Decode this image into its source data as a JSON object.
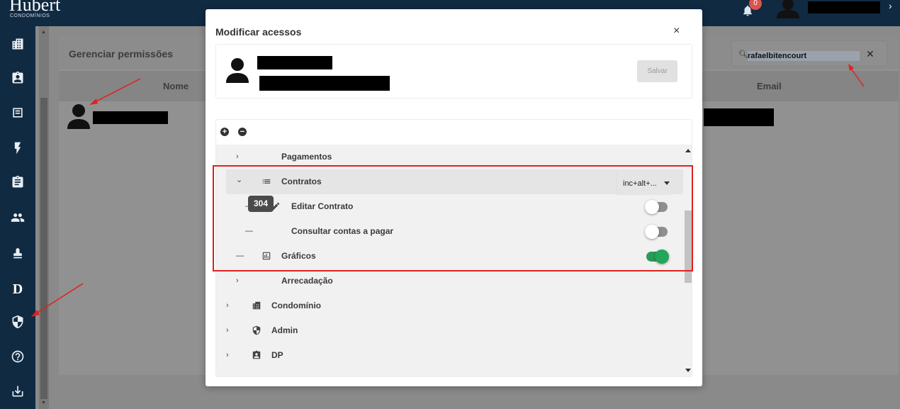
{
  "header": {
    "logo_text": "Hubert",
    "logo_subtext": "CONDOMÍNIOS",
    "notification_count": "0",
    "chevron": "›"
  },
  "sidebar": {
    "icons": [
      "buildings-icon",
      "contact-badge-icon",
      "receipt-icon",
      "lightning-icon",
      "clipboard-icon",
      "people-icon",
      "stamp-icon",
      "d-letter-icon",
      "shield-icon",
      "help-icon",
      "download-icon"
    ],
    "d_letter": "D"
  },
  "background_page": {
    "title": "Gerenciar permissões",
    "search_value": "rafaelbitencourt",
    "columns": [
      "Nome",
      "Email"
    ]
  },
  "modal": {
    "title": "Modificar acessos",
    "close_label": "×",
    "save_label": "Salvar",
    "toolbar": {
      "expand_label": "+",
      "collapse_label": "−"
    },
    "tree": [
      {
        "label": "Pagamentos",
        "chevron": "›",
        "state": "collapsed"
      },
      {
        "label": "Contratos",
        "chevron": "⌄",
        "state": "expanded",
        "icon": "list-icon",
        "select_value": "inc+alt+..."
      },
      {
        "label": "Editar Contrato",
        "chevron": "—",
        "icon": "pencil-icon",
        "toggle": "off"
      },
      {
        "label": "Consultar contas a pagar",
        "chevron": "—",
        "toggle": "off"
      },
      {
        "label": "Gráficos",
        "chevron": "—",
        "icon": "chart-icon",
        "toggle": "on"
      },
      {
        "label": "Arrecadação",
        "chevron": "›",
        "state": "collapsed"
      },
      {
        "label": "Condomínio",
        "chevron": "›",
        "icon": "buildings-icon",
        "state": "collapsed"
      },
      {
        "label": "Admin",
        "chevron": "›",
        "icon": "shield-icon",
        "state": "collapsed"
      },
      {
        "label": "DP",
        "chevron": "›",
        "icon": "badge-icon",
        "state": "collapsed"
      }
    ],
    "tooltip": "304"
  },
  "colors": {
    "navy": "#102a42",
    "toggle_on": "#23a55a",
    "annotation_red": "#e02020",
    "badge_red": "#d9534f"
  }
}
